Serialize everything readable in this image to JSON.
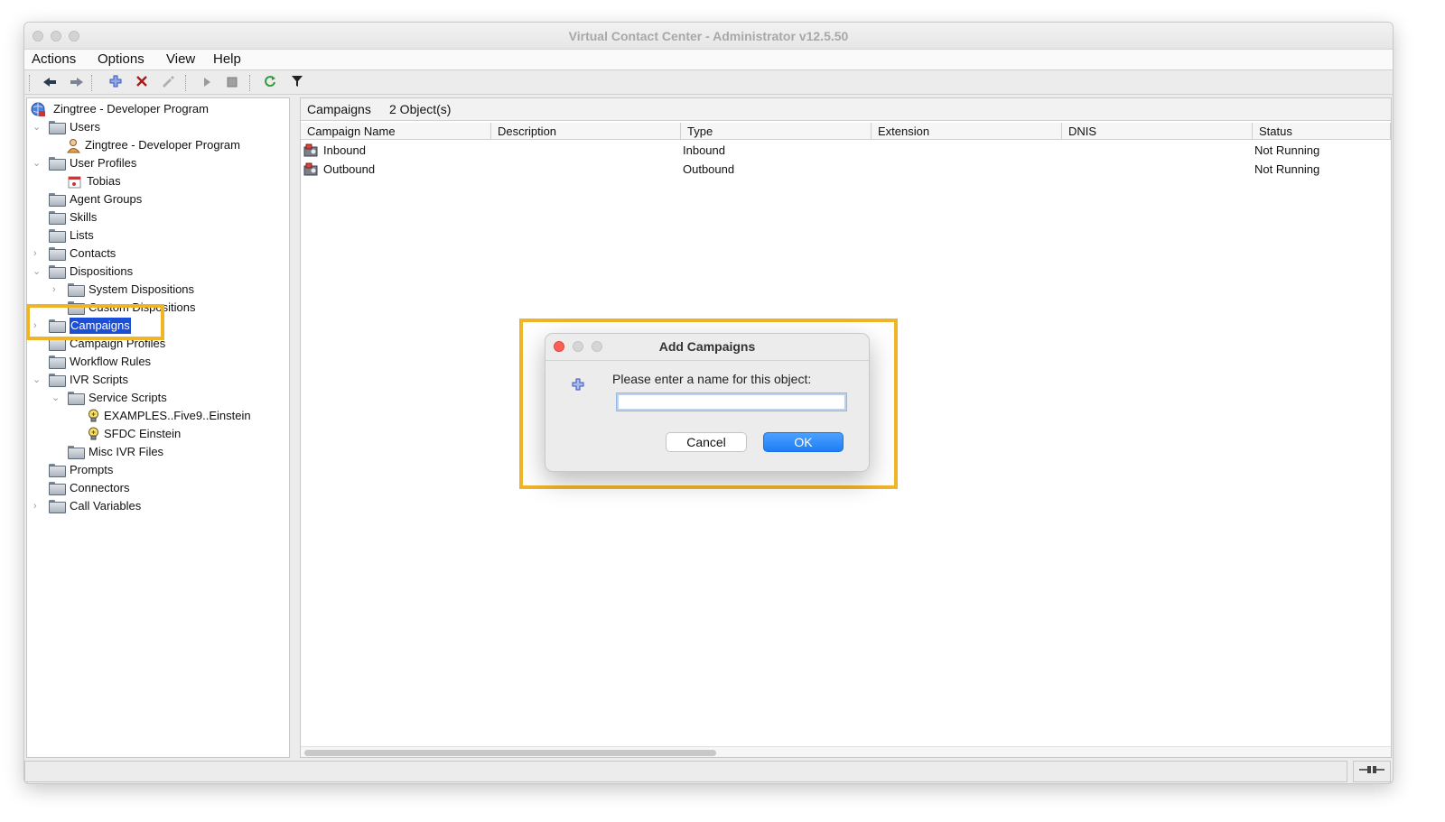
{
  "window": {
    "title": "Virtual Contact Center - Administrator v12.5.50"
  },
  "menubar": {
    "items": [
      "Actions",
      "Options",
      "View",
      "Help"
    ]
  },
  "toolbar": {
    "icons": [
      "back-arrow-icon",
      "forward-arrow-icon",
      "add-icon",
      "delete-icon",
      "edit-icon",
      "start-icon",
      "stop-icon",
      "refresh-icon",
      "filter-icon"
    ]
  },
  "tree": {
    "root": "Zingtree - Developer Program",
    "items": [
      {
        "label": "Users",
        "level": 1,
        "expanded": true
      },
      {
        "label": "Zingtree - Developer Program",
        "level": 2,
        "icon": "user-icon"
      },
      {
        "label": "User Profiles",
        "level": 1,
        "expanded": true
      },
      {
        "label": "Tobias",
        "level": 2,
        "icon": "calendar-icon"
      },
      {
        "label": "Agent Groups",
        "level": 1
      },
      {
        "label": "Skills",
        "level": 1
      },
      {
        "label": "Lists",
        "level": 1
      },
      {
        "label": "Contacts",
        "level": 1,
        "collapsed": true
      },
      {
        "label": "Dispositions",
        "level": 1,
        "expanded": true
      },
      {
        "label": "System Dispositions",
        "level": 2,
        "collapsed": true
      },
      {
        "label": "Custom Dispositions",
        "level": 2
      },
      {
        "label": "Campaigns",
        "level": 1,
        "collapsed": true,
        "selected": true
      },
      {
        "label": "Campaign Profiles",
        "level": 1
      },
      {
        "label": "Workflow Rules",
        "level": 1
      },
      {
        "label": "IVR Scripts",
        "level": 1,
        "expanded": true
      },
      {
        "label": "Service Scripts",
        "level": 2,
        "expanded": true
      },
      {
        "label": "EXAMPLES..Five9..Einstein",
        "level": 3,
        "icon": "script-icon"
      },
      {
        "label": "SFDC Einstein",
        "level": 3,
        "icon": "script-icon"
      },
      {
        "label": "Misc IVR Files",
        "level": 2
      },
      {
        "label": "Prompts",
        "level": 1
      },
      {
        "label": "Connectors",
        "level": 1
      },
      {
        "label": "Call Variables",
        "level": 1,
        "collapsed": true
      }
    ]
  },
  "content": {
    "title": "Campaigns",
    "count": "2 Object(s)",
    "columns": [
      "Campaign Name",
      "Description",
      "Type",
      "Extension",
      "DNIS",
      "Status"
    ],
    "rows": [
      {
        "name": "Inbound",
        "description": "",
        "type": "Inbound",
        "extension": "",
        "dnis": "",
        "status": "Not Running"
      },
      {
        "name": "Outbound",
        "description": "",
        "type": "Outbound",
        "extension": "",
        "dnis": "",
        "status": "Not Running"
      }
    ]
  },
  "dialog": {
    "title": "Add Campaigns",
    "prompt": "Please enter a name for this object:",
    "input_value": "",
    "cancel_label": "Cancel",
    "ok_label": "OK"
  },
  "colors": {
    "highlight": "#f0b428",
    "selection": "#1a4fd6",
    "primary_button": "#1f7ef5"
  }
}
